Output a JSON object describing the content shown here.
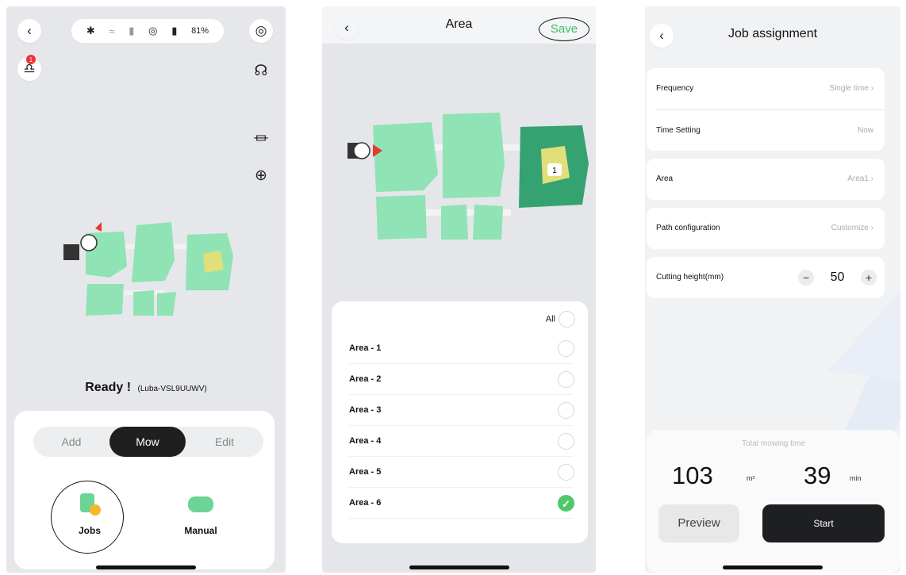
{
  "colors": {
    "accent_green": "#3dbb62",
    "lawn_light": "#8fe3b4",
    "lawn_dark": "#35a371",
    "lawn_yellow": "#e1df7a",
    "dark": "#1f1f1f"
  },
  "panel1": {
    "status_bar": {
      "battery_pct": "81%",
      "icons": [
        "bluetooth-icon",
        "wifi-icon",
        "signal-icon",
        "gps-icon",
        "battery-icon"
      ]
    },
    "notification_count": "1",
    "ready_text": "Ready !",
    "device_name": "(Luba-VSL9UUWV)",
    "tabs": [
      "Add",
      "Mow",
      "Edit"
    ],
    "active_tab": "Mow",
    "tools": [
      {
        "label": "Jobs",
        "icon": "jobs-icon"
      },
      {
        "label": "Manual",
        "icon": "gamepad-icon"
      }
    ]
  },
  "panel2": {
    "title": "Area",
    "save_label": "Save",
    "all_label": "All",
    "map_tag": "1",
    "areas": [
      {
        "label": "Area - 1",
        "checked": false
      },
      {
        "label": "Area - 2",
        "checked": false
      },
      {
        "label": "Area - 3",
        "checked": false
      },
      {
        "label": "Area - 4",
        "checked": false
      },
      {
        "label": "Area - 5",
        "checked": false
      },
      {
        "label": "Area - 6",
        "checked": true
      }
    ]
  },
  "panel3": {
    "title": "Job assignment",
    "frequency": {
      "label": "Frequency",
      "value": "Single time"
    },
    "time_setting": {
      "label": "Time Setting",
      "value": "Now"
    },
    "area": {
      "label": "Area",
      "value": "Area1"
    },
    "path": {
      "label": "Path configuration",
      "value": "Customize"
    },
    "cutting": {
      "label": "Cutting height(mm)",
      "value": "50",
      "minus": "−",
      "plus": "+"
    },
    "total_label": "Total mowing time",
    "area_value": "103",
    "area_unit": "m²",
    "time_value": "39",
    "time_unit": "min",
    "preview_label": "Preview",
    "start_label": "Start"
  }
}
